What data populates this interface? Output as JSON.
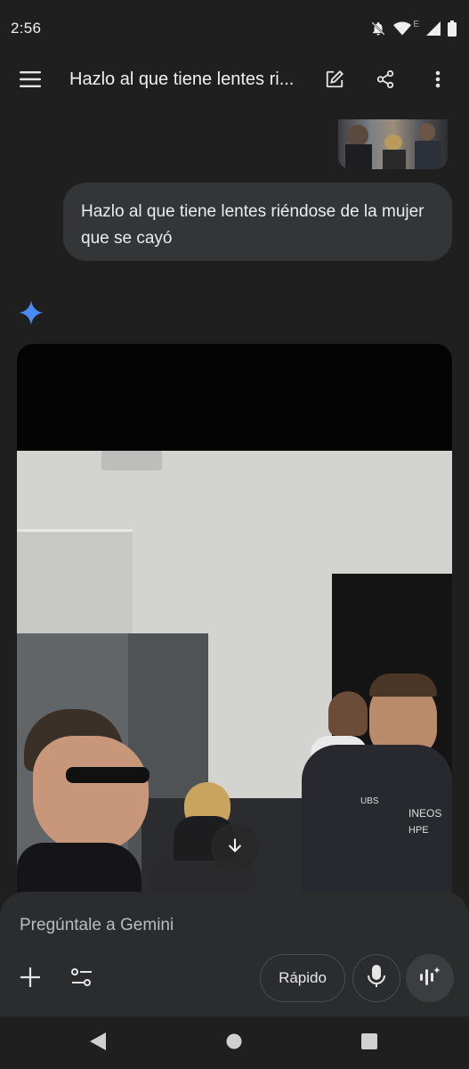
{
  "status_bar": {
    "time": "2:56",
    "icons": [
      "notifications-off-icon",
      "wifi-icon",
      "signal-icon",
      "battery-icon"
    ],
    "network_label": "E"
  },
  "app_bar": {
    "title": "Hazlo al que tiene lentes ri...",
    "icons": [
      "menu-icon",
      "edit-icon",
      "share-icon",
      "more-vert-icon"
    ]
  },
  "conversation": {
    "user_message": "Hazlo al que tiene lentes riéndose de la mujer que se cayó",
    "response": {
      "type": "generated-video",
      "icon": "gemini-sparkle-icon",
      "download_icon": "arrow-down-icon",
      "jersey_texts": [
        "UBS",
        "INEOS",
        "HPE"
      ]
    }
  },
  "composer": {
    "placeholder": "Pregúntale a Gemini",
    "model_label": "Rápido",
    "icons": [
      "plus-icon",
      "tools-icon",
      "mic-icon",
      "live-icon"
    ]
  },
  "nav_bar": {
    "icons": [
      "back-icon",
      "home-icon",
      "recents-icon"
    ]
  },
  "colors": {
    "background": "#1f1f1f",
    "bubble": "#333537",
    "composer": "#2b2c2e",
    "sparkle": "#4a8af4"
  }
}
